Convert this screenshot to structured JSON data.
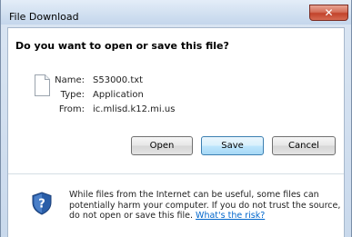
{
  "window": {
    "title": "File Download",
    "close_symbol": "✕"
  },
  "dialog": {
    "question": "Do you want to open or save this file?",
    "file_icon": "blank-file-icon",
    "fields": {
      "name_label": "Name:",
      "name_value": "S53000.txt",
      "type_label": "Type:",
      "type_value": "Application",
      "from_label": "From:",
      "from_value": "ic.mlisd.k12.mi.us"
    },
    "buttons": {
      "open": "Open",
      "save": "Save",
      "cancel": "Cancel"
    },
    "warning": {
      "icon": "shield-question-icon",
      "text": "While files from the Internet can be useful, some files can potentially harm your computer. If you do not trust the source, do not open or save this file.",
      "link": "What's the risk?"
    }
  },
  "colors": {
    "link": "#0066cc",
    "close_button": "#c2432b",
    "default_button_border": "#3c7fb1",
    "shield_blue": "#2a5ea8"
  }
}
